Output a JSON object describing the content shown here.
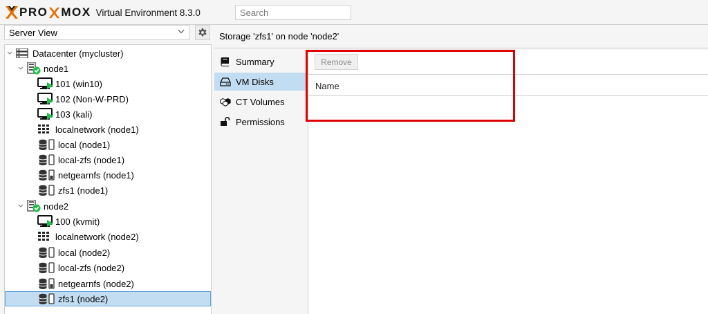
{
  "header": {
    "logo_text_1": "PRO",
    "logo_text_2": "MOX",
    "version": "Virtual Environment 8.3.0",
    "search_placeholder": "Search"
  },
  "left": {
    "view_select": "Server View"
  },
  "tree": {
    "datacenter": "Datacenter (mycluster)",
    "node1": {
      "label": "node1",
      "items": [
        {
          "label": "101 (win10)",
          "icon": "vm-running-icon"
        },
        {
          "label": "102 (Non-W-PRD)",
          "icon": "vm-running-icon"
        },
        {
          "label": "103 (kali)",
          "icon": "vm-running-icon"
        },
        {
          "label": "localnetwork (node1)",
          "icon": "network-icon"
        },
        {
          "label": "local (node1)",
          "icon": "storage-icon"
        },
        {
          "label": "local-zfs (node1)",
          "icon": "storage-icon"
        },
        {
          "label": "netgearnfs (node1)",
          "icon": "storage-shared-icon"
        },
        {
          "label": "zfs1 (node1)",
          "icon": "storage-icon"
        }
      ]
    },
    "node2": {
      "label": "node2",
      "items": [
        {
          "label": "100 (kvmit)",
          "icon": "vm-running-icon"
        },
        {
          "label": "localnetwork (node2)",
          "icon": "network-icon"
        },
        {
          "label": "local (node2)",
          "icon": "storage-icon"
        },
        {
          "label": "local-zfs (node2)",
          "icon": "storage-icon"
        },
        {
          "label": "netgearnfs (node2)",
          "icon": "storage-shared-icon"
        },
        {
          "label": "zfs1 (node2)",
          "icon": "storage-icon",
          "selected": true
        }
      ]
    }
  },
  "main": {
    "title": "Storage 'zfs1' on node 'node2'",
    "nav": [
      {
        "label": "Summary",
        "icon": "book-icon"
      },
      {
        "label": "VM Disks",
        "icon": "hdd-icon",
        "active": true
      },
      {
        "label": "CT Volumes",
        "icon": "cubes-icon"
      },
      {
        "label": "Permissions",
        "icon": "unlock-icon"
      }
    ],
    "toolbar": {
      "remove_label": "Remove"
    },
    "grid": {
      "columns": [
        "Name"
      ],
      "rows": []
    }
  },
  "colors": {
    "accent_selected": "#c2ddf2",
    "logo_orange": "#e57000",
    "running_green": "#21bf4b",
    "highlight_red": "#e00000"
  }
}
